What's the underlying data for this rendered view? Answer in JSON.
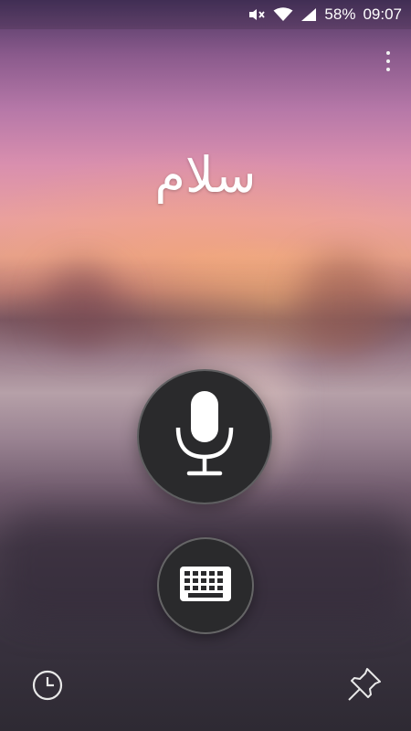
{
  "status_bar": {
    "battery": "58%",
    "time": "09:07",
    "icons": [
      "mute-icon",
      "wifi-icon",
      "cell-signal-icon"
    ]
  },
  "main": {
    "phrase": "سلام"
  },
  "controls": {
    "mic_icon": "microphone-icon",
    "keyboard_icon": "keyboard-icon",
    "history_icon": "clock-icon",
    "pin_icon": "pin-icon",
    "overflow_icon": "more-vert-icon"
  },
  "colors": {
    "button_bg": "#2a2a2c",
    "icon": "#ffffff"
  }
}
